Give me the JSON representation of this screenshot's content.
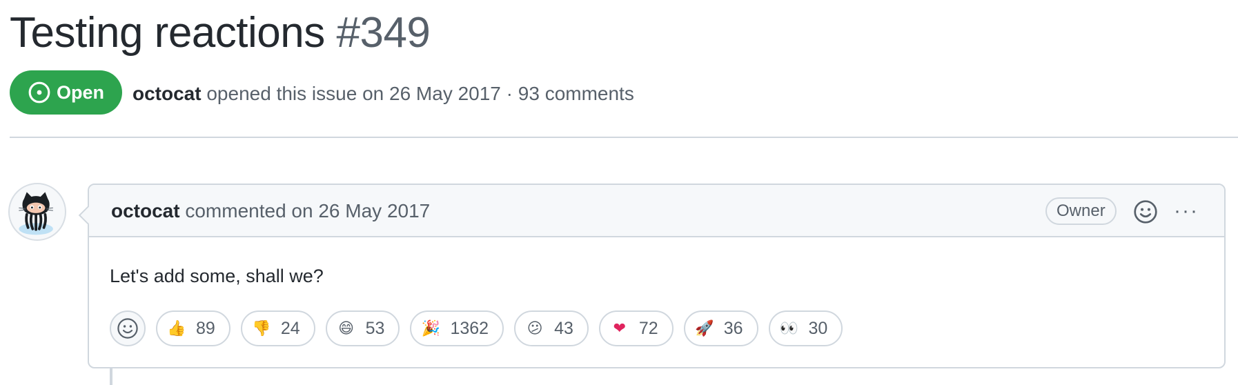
{
  "issue": {
    "title": "Testing reactions",
    "number": "#349",
    "state": "Open",
    "author": "octocat",
    "meta_text": "opened this issue on 26 May 2017 · 93 comments",
    "state_color": "#2da44e"
  },
  "comment": {
    "author": "octocat",
    "meta": "commented on 26 May 2017",
    "role_badge": "Owner",
    "body": "Let's add some, shall we?",
    "reactions": [
      {
        "icon": "thumbs-up-icon",
        "glyph": "👍",
        "count": "89"
      },
      {
        "icon": "thumbs-down-icon",
        "glyph": "👎",
        "count": "24"
      },
      {
        "icon": "laugh-icon",
        "glyph": "😄",
        "count": "53"
      },
      {
        "icon": "hooray-icon",
        "glyph": "🎉",
        "count": "1362"
      },
      {
        "icon": "confused-icon",
        "glyph": "😕",
        "count": "43"
      },
      {
        "icon": "heart-icon",
        "glyph": "❤",
        "count": "72"
      },
      {
        "icon": "rocket-icon",
        "glyph": "🚀",
        "count": "36"
      },
      {
        "icon": "eyes-icon",
        "glyph": "👀",
        "count": "30"
      }
    ]
  }
}
